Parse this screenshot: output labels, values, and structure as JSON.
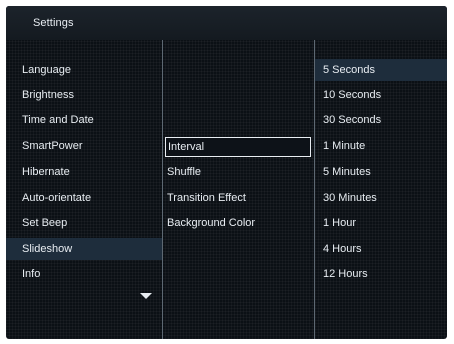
{
  "header": {
    "title": "Settings"
  },
  "menu": {
    "items": [
      {
        "label": "Language"
      },
      {
        "label": "Brightness"
      },
      {
        "label": "Time and Date"
      },
      {
        "label": "SmartPower"
      },
      {
        "label": "Hibernate"
      },
      {
        "label": "Auto-orientate"
      },
      {
        "label": "Set Beep"
      },
      {
        "label": "Slideshow",
        "selected": true
      },
      {
        "label": "Info"
      }
    ],
    "more_indicator": "chevron-down-icon"
  },
  "submenu": {
    "items": [
      {
        "label": "Interval",
        "focused": true
      },
      {
        "label": "Shuffle"
      },
      {
        "label": "Transition Effect"
      },
      {
        "label": "Background Color"
      }
    ]
  },
  "options": {
    "items": [
      {
        "label": "5 Seconds",
        "selected": true
      },
      {
        "label": "10 Seconds"
      },
      {
        "label": "30 Seconds"
      },
      {
        "label": "1 Minute"
      },
      {
        "label": "5 Minutes"
      },
      {
        "label": "30 Minutes"
      },
      {
        "label": "1 Hour"
      },
      {
        "label": "4 Hours"
      },
      {
        "label": "12 Hours"
      }
    ]
  },
  "colors": {
    "background": "#0b1015",
    "header": "#1c232b",
    "highlight": "#1e2d3c",
    "text": "#e8edf2",
    "divider": "#5d6872"
  }
}
